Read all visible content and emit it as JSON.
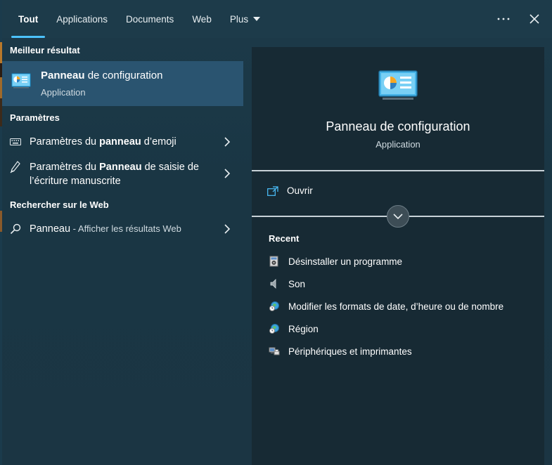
{
  "tabs": [
    {
      "label": "Tout",
      "active": true
    },
    {
      "label": "Applications"
    },
    {
      "label": "Documents"
    },
    {
      "label": "Web"
    },
    {
      "label": "Plus"
    }
  ],
  "left": {
    "best_header": "Meilleur résultat",
    "best": {
      "title_bold": "Panneau",
      "title_rest": " de configuration",
      "subtitle": "Application"
    },
    "settings_header": "Paramètres",
    "settings": [
      {
        "pre": "Paramètres du ",
        "bold": "panneau",
        "post": " d’emoji"
      },
      {
        "pre": "Paramètres du ",
        "bold": "Panneau",
        "post": " de saisie de",
        "line2": "l’écriture manuscrite"
      }
    ],
    "web_header": "Rechercher sur le Web",
    "web": {
      "query": "Panneau",
      "suffix": " - Afficher les résultats Web"
    }
  },
  "right": {
    "title": "Panneau de configuration",
    "subtitle": "Application",
    "open_label": "Ouvrir",
    "recent_header": "Recent",
    "recent": [
      {
        "label": "Désinstaller un programme",
        "icon": "programs-icon"
      },
      {
        "label": "Son",
        "icon": "speaker-icon"
      },
      {
        "label": "Modifier les formats de date, d’heure ou de nombre",
        "icon": "globe-clock-icon"
      },
      {
        "label": "Région",
        "icon": "globe-clock-icon"
      },
      {
        "label": "Périphériques et imprimantes",
        "icon": "devices-printers-icon"
      }
    ]
  },
  "colors": {
    "accent": "#4cc2ff",
    "selected_row": "#2a5470",
    "panel_bg": "#1c3a49",
    "preview_bg": "#172a34"
  }
}
